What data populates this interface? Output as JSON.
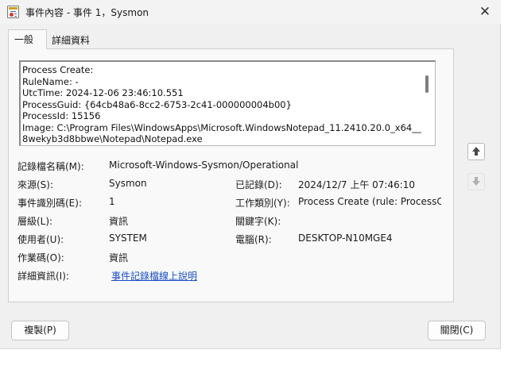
{
  "window": {
    "title": "事件內容 - 事件 1，Sysmon"
  },
  "icons": {
    "title": "event-log-icon",
    "close": "close-icon",
    "up": "arrow-up-icon",
    "down": "arrow-down-icon"
  },
  "tabs": [
    {
      "label": "一般",
      "selected": true
    },
    {
      "label": "詳細資料",
      "selected": false
    }
  ],
  "description": {
    "lines": [
      "Process Create:",
      "RuleName: -",
      "UtcTime: 2024-12-06 23:46:10.551",
      "ProcessGuid: {64cb48a6-8cc2-6753-2c41-000000004b00}",
      "ProcessId: 15156",
      "Image: C:\\Program Files\\WindowsApps\\Microsoft.WindowsNotepad_11.2410.20.0_x64__",
      "8wekyb3d8bbwe\\Notepad\\Notepad.exe"
    ]
  },
  "fields": {
    "log_name": {
      "label": "記錄檔名稱(M):",
      "value": "Microsoft-Windows-Sysmon/Operational"
    },
    "source": {
      "label": "來源(S):",
      "value": "Sysmon"
    },
    "logged": {
      "label": "已記錄(D):",
      "value": "2024/12/7 上午 07:46:10"
    },
    "event_id": {
      "label": "事件識別碼(E):",
      "value": "1"
    },
    "task_category": {
      "label": "工作類別(Y):",
      "value": "Process Create (rule: ProcessCreat"
    },
    "level": {
      "label": "層級(L):",
      "value": "資訊"
    },
    "keywords": {
      "label": "關鍵字(K):",
      "value": ""
    },
    "user": {
      "label": "使用者(U):",
      "value": "SYSTEM"
    },
    "computer": {
      "label": "電腦(R):",
      "value": "DESKTOP-N10MGE4"
    },
    "opcode": {
      "label": "作業碼(O):",
      "value": "資訊"
    },
    "more_info": {
      "label": "詳細資訊(I):",
      "link": "事件記錄檔線上說明"
    }
  },
  "buttons": {
    "copy": "複製(P)",
    "close": "關閉(C)"
  },
  "colors": {
    "link": "#1a4ec8",
    "dialog_bg": "#f0f0f0",
    "panel_bg": "#f9f9f9"
  }
}
